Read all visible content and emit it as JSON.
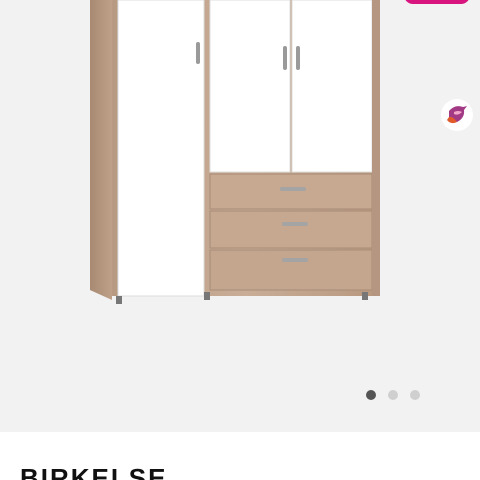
{
  "gallery": {
    "image_label": "wardrobe-photo",
    "current_slide": 1,
    "total_slides": 3,
    "badge_color": "#d8147e",
    "icon": "bird-logo-icon"
  },
  "product": {
    "title": "BIRKELSE"
  }
}
